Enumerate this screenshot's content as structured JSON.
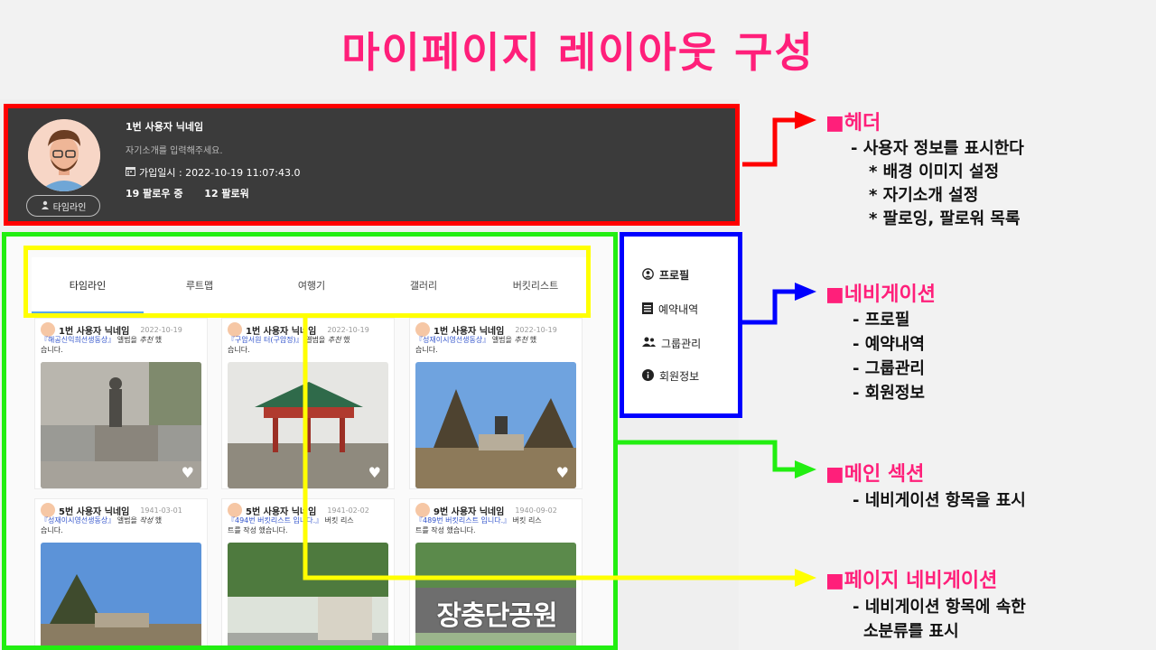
{
  "slide_title": "마이페이지 레이아웃 구성",
  "header": {
    "user_name": "1번 사용자 닉네임",
    "bio": "자기소개를 입력해주세요.",
    "join_date": "가입일시 : 2022-10-19 11:07:43.0",
    "following": "19 팔로우 중",
    "followers": "12 팔로워",
    "timeline_button": "타임라인"
  },
  "tabs": [
    "타임라인",
    "루트맵",
    "여행기",
    "갤러리",
    "버킷리스트"
  ],
  "cards": [
    {
      "user": "1번 사용자 닉네임",
      "date": "2022-10-19",
      "place": "『해공신익희선생동상』",
      "action_pre": " 앨범을 ",
      "action_verb": "추천",
      "action_post": " 했",
      "line2": "습니다."
    },
    {
      "user": "1번 사용자 닉네임",
      "date": "2022-10-19",
      "place": "『구암서원 터(구암정)』",
      "action_pre": " 앨범을 ",
      "action_verb": "추천",
      "action_post": " 했",
      "line2": "습니다."
    },
    {
      "user": "1번 사용자 닉네임",
      "date": "2022-10-19",
      "place": "『성재이시영선생동상』",
      "action_pre": " 앨범을 ",
      "action_verb": "추천",
      "action_post": " 했",
      "line2": "습니다."
    },
    {
      "user": "5번 사용자 닉네임",
      "date": "1941-03-01",
      "place": "『성재이시영선생동상』",
      "action_pre": " 앨범을 ",
      "action_verb": "작성",
      "action_post": " 했",
      "line2": "습니다."
    },
    {
      "user": "5번 사용자 닉네임",
      "date": "1941-02-02",
      "place": "『494번 버킷리스트 입니다.』",
      "action_pre": " 버킷 리스",
      "action_verb": "",
      "action_post": "",
      "line2": "트를 작성 했습니다."
    },
    {
      "user": "9번 사용자 닉네임",
      "date": "1940-09-02",
      "place": "『489번 버킷리스트 입니다.』",
      "action_pre": " 버킷 리스",
      "action_verb": "",
      "action_post": "",
      "line2": "트를 작성 했습니다."
    }
  ],
  "park_sign": "장충단공원",
  "nav": [
    "프로필",
    "예약내역",
    "그룹관리",
    "회원정보"
  ],
  "annotations": {
    "header": {
      "title": "■헤더",
      "lines": [
        "- 사용자 정보를 표시한다",
        "* 배경 이미지 설정",
        "* 자기소개 설정",
        "* 팔로잉, 팔로워 목록"
      ]
    },
    "nav": {
      "title": "■네비게이션",
      "lines": [
        "- 프로필",
        "- 예약내역",
        "- 그룹관리",
        "- 회원정보"
      ]
    },
    "main": {
      "title": "■메인 섹션",
      "lines": [
        "- 네비게이션 항목을 표시"
      ]
    },
    "page_nav": {
      "title": "■페이지 네비게이션",
      "lines": [
        "- 네비게이션 항목에 속한",
        "소분류를 표시"
      ]
    }
  },
  "colors": {
    "header_box": "#ff0000",
    "main_box": "#22ee11",
    "nav_box": "#0000ff",
    "page_nav_box": "#ffff00",
    "title": "#ff1f7a"
  }
}
